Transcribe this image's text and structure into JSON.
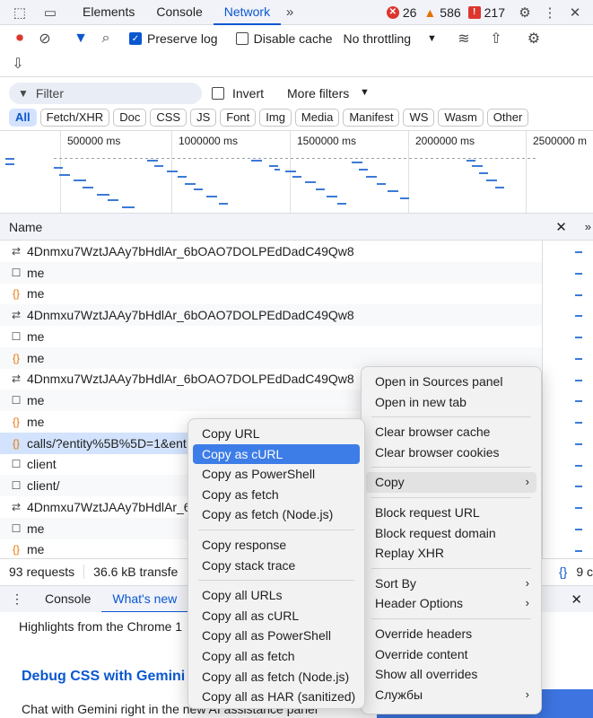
{
  "tabbar": {
    "tabs": [
      "Elements",
      "Console",
      "Network"
    ],
    "active": "Network",
    "errors": "26",
    "warnings": "586",
    "issues": "217"
  },
  "toolbar": {
    "preserve_log": "Preserve log",
    "disable_cache": "Disable cache",
    "throttling": "No throttling"
  },
  "filterbar": {
    "filter_placeholder": "Filter",
    "invert": "Invert",
    "more_filters": "More filters",
    "types": [
      "All",
      "Fetch/XHR",
      "Doc",
      "CSS",
      "JS",
      "Font",
      "Img",
      "Media",
      "Manifest",
      "WS",
      "Wasm",
      "Other"
    ]
  },
  "overview": {
    "ticks": [
      "500000 ms",
      "1000000 ms",
      "1500000 ms",
      "2000000 ms",
      "2500000 m"
    ]
  },
  "table": {
    "header": "Name",
    "rows": [
      {
        "icon": "xhr",
        "name": "4Dnmxu7WztJAAy7bHdlAr_6bOAO7DOLPEdDadC49Qw8"
      },
      {
        "icon": "doc",
        "name": "me"
      },
      {
        "icon": "js",
        "name": "me"
      },
      {
        "icon": "xhr",
        "name": "4Dnmxu7WztJAAy7bHdlAr_6bOAO7DOLPEdDadC49Qw8"
      },
      {
        "icon": "doc",
        "name": "me"
      },
      {
        "icon": "js",
        "name": "me"
      },
      {
        "icon": "xhr",
        "name": "4Dnmxu7WztJAAy7bHdlAr_6bOAO7DOLPEdDadC49Qw8"
      },
      {
        "icon": "doc",
        "name": "me"
      },
      {
        "icon": "js",
        "name": "me"
      },
      {
        "icon": "js",
        "name": "calls/?entity%5B%5D=1&ent"
      },
      {
        "icon": "doc",
        "name": "client"
      },
      {
        "icon": "doc",
        "name": "client/"
      },
      {
        "icon": "xhr",
        "name": "4Dnmxu7WztJAAy7bHdlAr_6"
      },
      {
        "icon": "doc",
        "name": "me"
      },
      {
        "icon": "js",
        "name": "me"
      }
    ]
  },
  "status": {
    "requests": "93 requests",
    "transferred": "36.6 kB transfe",
    "right": "9 c"
  },
  "drawer": {
    "tabs": [
      "Console",
      "What's new"
    ],
    "highlights": "Highlights from the Chrome 1",
    "heading": "Debug CSS with Gemini",
    "paragraph": "Chat with Gemini right in the new AI assistance panel"
  },
  "menu_left": {
    "groups": [
      [
        "Copy URL",
        "Copy as cURL",
        "Copy as PowerShell",
        "Copy as fetch",
        "Copy as fetch (Node.js)"
      ],
      [
        "Copy response",
        "Copy stack trace"
      ],
      [
        "Copy all URLs",
        "Copy all as cURL",
        "Copy all as PowerShell",
        "Copy all as fetch",
        "Copy all as fetch (Node.js)",
        "Copy all as HAR (sanitized)"
      ]
    ],
    "highlighted": "Copy as cURL"
  },
  "menu_right": {
    "groups": [
      [
        "Open in Sources panel",
        "Open in new tab"
      ],
      [
        "Clear browser cache",
        "Clear browser cookies"
      ],
      [
        "Copy"
      ],
      [
        "Block request URL",
        "Block request domain",
        "Replay XHR"
      ],
      [
        "Sort By",
        "Header Options"
      ],
      [
        "Override headers",
        "Override content",
        "Show all overrides",
        "Службы"
      ]
    ],
    "submenus": [
      "Copy",
      "Sort By",
      "Header Options",
      "Службы"
    ],
    "active_submenu": "Copy"
  }
}
